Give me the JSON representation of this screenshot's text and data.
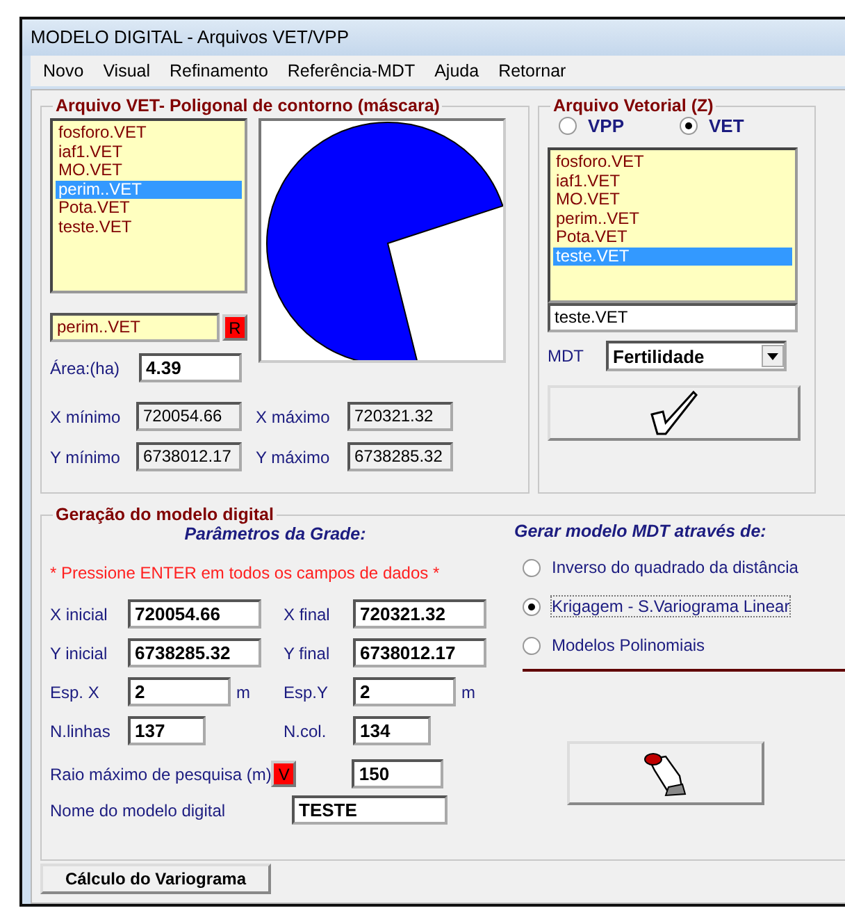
{
  "window": {
    "title": "MODELO DIGITAL - Arquivos VET/VPP"
  },
  "menu": [
    "Novo",
    "Visual",
    "Refinamento",
    "Referência-MDT",
    "Ajuda",
    "Retornar"
  ],
  "mask_group": {
    "title": "Arquivo  VET- Poligonal de contorno (máscara)",
    "files": [
      {
        "name": "fosforo.VET",
        "selected": false
      },
      {
        "name": "iaf1.VET",
        "selected": false
      },
      {
        "name": "MO.VET",
        "selected": false
      },
      {
        "name": "perim..VET",
        "selected": true
      },
      {
        "name": "Pota.VET",
        "selected": false
      },
      {
        "name": "teste.VET",
        "selected": false
      }
    ],
    "file_field": "perim..VET",
    "r_button": "R",
    "area_label": "Área:(ha)",
    "area_value": "4.39",
    "extents": [
      {
        "label": "X mínimo",
        "value": "720054.66"
      },
      {
        "label": "X máximo",
        "value": "720321.32"
      },
      {
        "label": "Y mínimo",
        "value": "6738012.17"
      },
      {
        "label": "Y máximo",
        "value": "6738285.32"
      }
    ]
  },
  "vector_group": {
    "title": "Arquivo Vetorial (Z)",
    "formats": [
      {
        "label": "VPP",
        "selected": false
      },
      {
        "label": "VET",
        "selected": true
      }
    ],
    "files": [
      {
        "name": "fosforo.VET",
        "selected": false
      },
      {
        "name": "iaf1.VET",
        "selected": false
      },
      {
        "name": "MO.VET",
        "selected": false
      },
      {
        "name": "perim..VET",
        "selected": false
      },
      {
        "name": "Pota.VET",
        "selected": false
      },
      {
        "name": "teste.VET",
        "selected": true
      }
    ],
    "file_field": "teste.VET",
    "mdt_label": "MDT",
    "mdt_value": "Fertilidade"
  },
  "generation": {
    "title": "Geração do modelo digital",
    "grid_heading": "Parâmetros da Grade:",
    "hint": "*  Pressione ENTER em todos os campos de dados *",
    "params": [
      {
        "label": "X inicial",
        "value": "720054.66"
      },
      {
        "label": "X final",
        "value": "720321.32"
      },
      {
        "label": "Y inicial",
        "value": "6738285.32"
      },
      {
        "label": "Y final",
        "value": "6738012.17"
      },
      {
        "label": "Esp. X",
        "value": "2",
        "unit": "m"
      },
      {
        "label": "Esp.Y",
        "value": "2",
        "unit": "m"
      },
      {
        "label": "N.linhas",
        "value": "137"
      },
      {
        "label": "N.col.",
        "value": "134"
      }
    ],
    "radius_label": "Raio máximo de pesquisa (m)",
    "v_button": "V",
    "radius_value": "150",
    "name_label": "Nome do modelo digital",
    "name_value": "TESTE",
    "method_heading": "Gerar modelo MDT através de:",
    "methods": [
      {
        "label": "Inverso do quadrado da distância",
        "selected": false
      },
      {
        "label": "Krigagem  - S.Variograma Linear",
        "selected": true
      },
      {
        "label": "Modelos Polinomiais",
        "selected": false
      }
    ],
    "variogram_button": "Cálculo do Variograma"
  }
}
